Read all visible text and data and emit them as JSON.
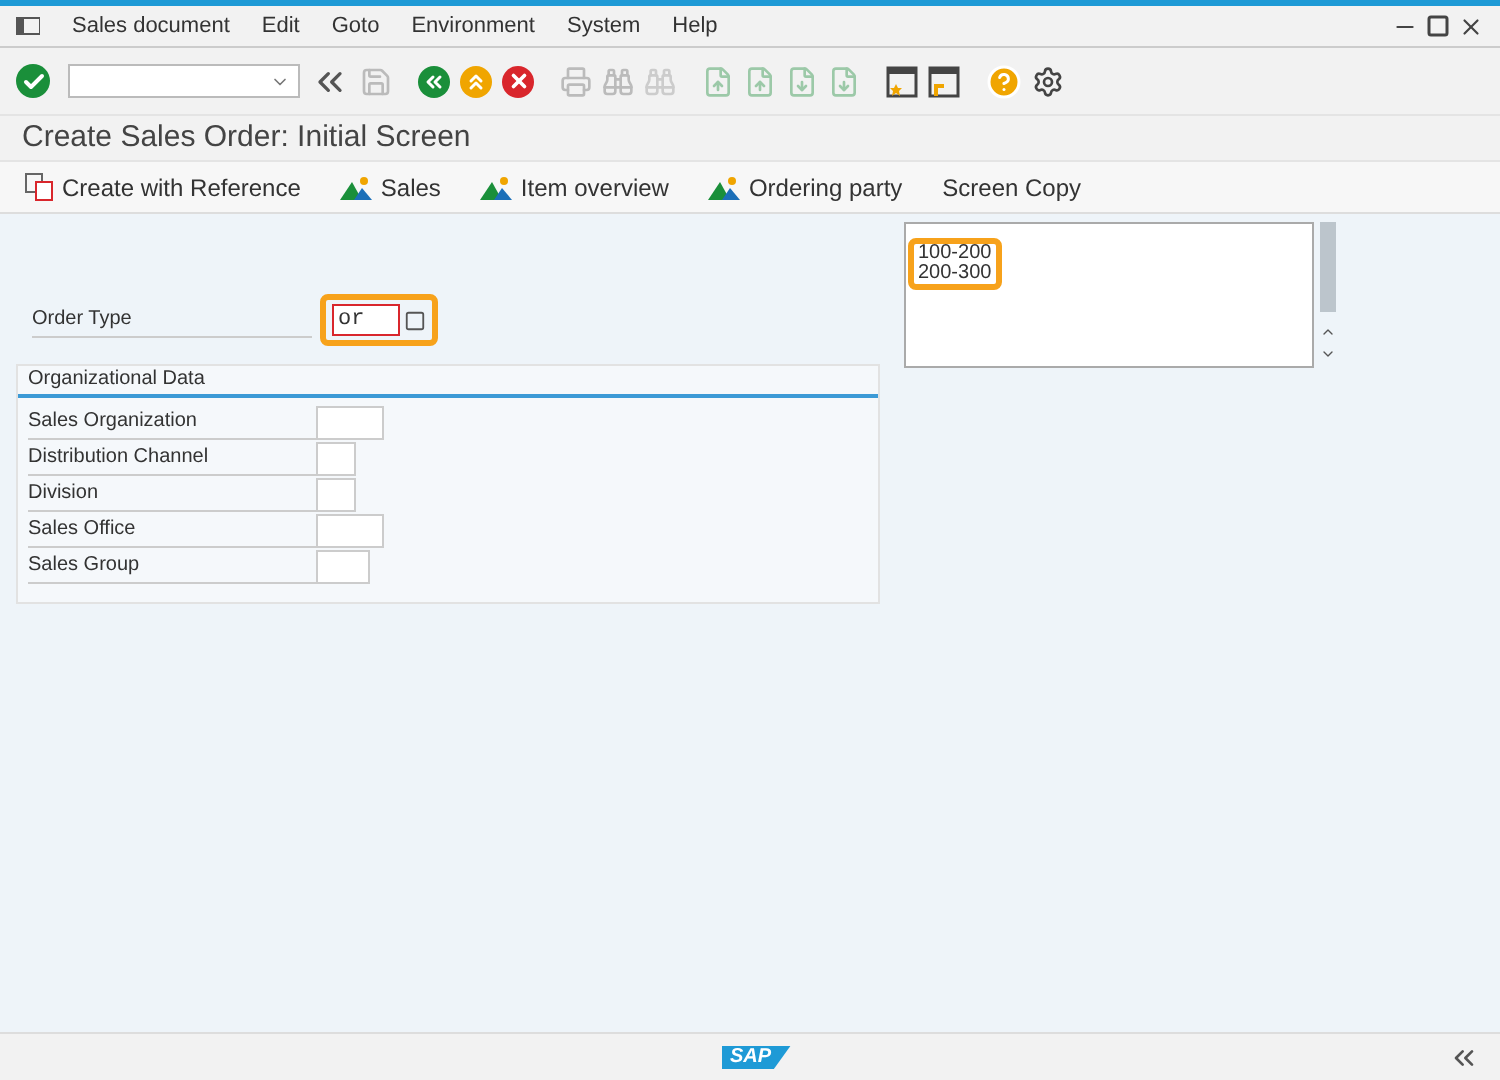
{
  "menu": [
    "Sales document",
    "Edit",
    "Goto",
    "Environment",
    "System",
    "Help"
  ],
  "title": "Create Sales Order: Initial Screen",
  "app_toolbar": [
    {
      "label": "Create with Reference",
      "kind": "reference"
    },
    {
      "label": "Sales",
      "kind": "mountain"
    },
    {
      "label": "Item overview",
      "kind": "mountain"
    },
    {
      "label": "Ordering party",
      "kind": "mountain"
    },
    {
      "label": "Screen Copy",
      "kind": "plain"
    }
  ],
  "order_type": {
    "label": "Order Type",
    "value": "or",
    "highlighted": true
  },
  "org_data": {
    "title": "Organizational Data",
    "fields": [
      {
        "label": "Sales Organization"
      },
      {
        "label": "Distribution Channel"
      },
      {
        "label": "Division"
      },
      {
        "label": "Sales Office"
      },
      {
        "label": "Sales Group"
      }
    ]
  },
  "list_box": {
    "items": [
      "100-200",
      "200-300"
    ],
    "highlighted": true
  },
  "status_bar": {
    "logo": "SAP"
  }
}
